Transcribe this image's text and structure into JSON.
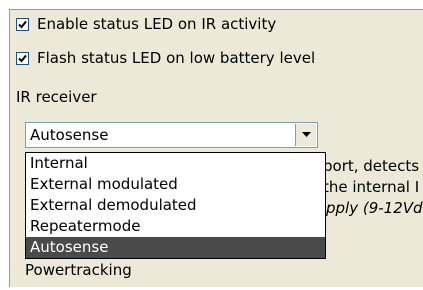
{
  "options": {
    "enable_status_led": {
      "label": "Enable status LED on IR activity",
      "checked": true
    },
    "flash_status_led": {
      "label": "Flash status LED on low battery level",
      "checked": true
    }
  },
  "ir_receiver": {
    "section_label": "IR receiver",
    "selected_value": "Autosense",
    "dropdown_options": [
      "Internal",
      "External modulated",
      "External demodulated",
      "Repeatermode",
      "Autosense"
    ],
    "highlighted_option": "Autosense"
  },
  "obscured_text": {
    "line1": "port, detects",
    "line2": "the internal I",
    "line3": "pply (9-12Vd",
    "line4": "Powertracking"
  }
}
